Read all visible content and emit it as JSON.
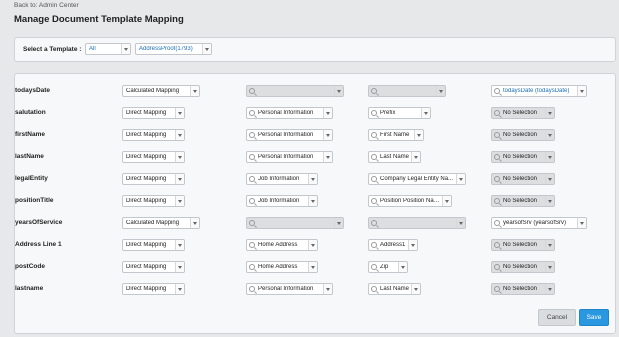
{
  "header": {
    "back_link": "Back to: Admin Center",
    "title": "Manage Document Template Mapping"
  },
  "template_selector": {
    "label": "Select a Template :",
    "category_value": "All",
    "template_value": "AddressProof(1793)"
  },
  "rows": [
    {
      "label": "todaysDate",
      "mapping_type": "Calculated Mapping",
      "entity": "",
      "field": "",
      "result": "todaysDate (todaysDate)"
    },
    {
      "label": "salutation",
      "mapping_type": "Direct Mapping",
      "entity": "Personal Information",
      "field": "Prefix",
      "result": "No Selection"
    },
    {
      "label": "firstName",
      "mapping_type": "Direct Mapping",
      "entity": "Personal Information",
      "field": "First Name",
      "result": "No Selection"
    },
    {
      "label": "lastName",
      "mapping_type": "Direct Mapping",
      "entity": "Personal Information",
      "field": "Last Name",
      "result": "No Selection"
    },
    {
      "label": "legalEntity",
      "mapping_type": "Direct Mapping",
      "entity": "Job Information",
      "field": "Company Legal Entity Na...",
      "result": "No Selection"
    },
    {
      "label": "positionTitle",
      "mapping_type": "Direct Mapping",
      "entity": "Job Information",
      "field": "Position Position Name",
      "result": "No Selection"
    },
    {
      "label": "yearsOfService",
      "mapping_type": "Calculated Mapping",
      "entity": "",
      "field": "",
      "result": "yearsofSrv (yearsofSrv)"
    },
    {
      "label": "Address Line 1",
      "mapping_type": "Direct Mapping",
      "entity": "Home Address",
      "field": "Address1",
      "result": "No Selection"
    },
    {
      "label": "postCode",
      "mapping_type": "Direct Mapping",
      "entity": "Home Address",
      "field": "Zip",
      "result": "No Selection"
    },
    {
      "label": "lastname",
      "mapping_type": "Direct Mapping",
      "entity": "Personal Information",
      "field": "Last Name",
      "result": "No Selection"
    }
  ],
  "actions": {
    "cancel_label": "Cancel",
    "save_label": "Save"
  },
  "colors": {
    "accent": "#2a98e0",
    "link_text": "#1a6fb5",
    "disabled_field": "#dcdee0"
  }
}
